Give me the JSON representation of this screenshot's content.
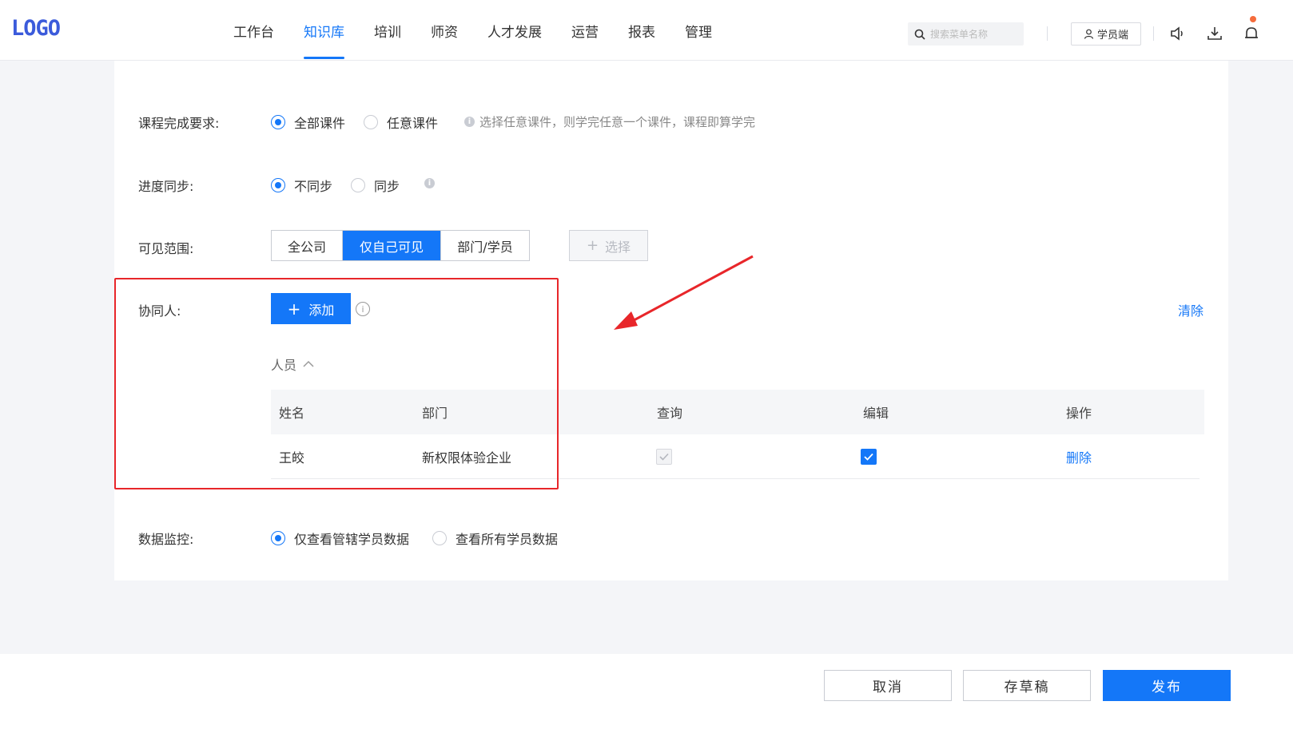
{
  "header": {
    "logo": "LOGO",
    "nav": [
      {
        "label": "工作台",
        "active": false
      },
      {
        "label": "知识库",
        "active": true
      },
      {
        "label": "培训",
        "active": false
      },
      {
        "label": "师资",
        "active": false
      },
      {
        "label": "人才发展",
        "active": false
      },
      {
        "label": "运营",
        "active": false
      },
      {
        "label": "报表",
        "active": false
      },
      {
        "label": "管理",
        "active": false
      }
    ],
    "search_placeholder": "搜索菜单名称",
    "student_label": "学员端"
  },
  "form": {
    "completion": {
      "label": "课程完成要求:",
      "options": [
        "全部课件",
        "任意课件"
      ],
      "selected": 0,
      "hint": "选择任意课件，则学完任意一个课件，课程即算学完"
    },
    "sync": {
      "label": "进度同步:",
      "options": [
        "不同步",
        "同步"
      ],
      "selected": 0
    },
    "visibility": {
      "label": "可见范围:",
      "options": [
        "全公司",
        "仅自己可见",
        "部门/学员"
      ],
      "selected": 1,
      "select_label": "选择"
    },
    "collaborators": {
      "label": "协同人:",
      "add_label": "添加",
      "info_glyph": "i",
      "clear_label": "清除",
      "people_label": "人员",
      "columns": [
        "姓名",
        "部门",
        "查询",
        "编辑",
        "操作"
      ],
      "rows": [
        {
          "name": "王皎",
          "dept": "新权限体验企业",
          "query": true,
          "query_disabled": true,
          "edit": true,
          "action": "删除"
        }
      ]
    },
    "monitor": {
      "label": "数据监控:",
      "options": [
        "仅查看管辖学员数据",
        "查看所有学员数据"
      ],
      "selected": 0
    }
  },
  "footer": {
    "cancel": "取消",
    "draft": "存草稿",
    "publish": "发布"
  },
  "colors": {
    "primary": "#1477f8",
    "annotation": "#e8262a"
  }
}
